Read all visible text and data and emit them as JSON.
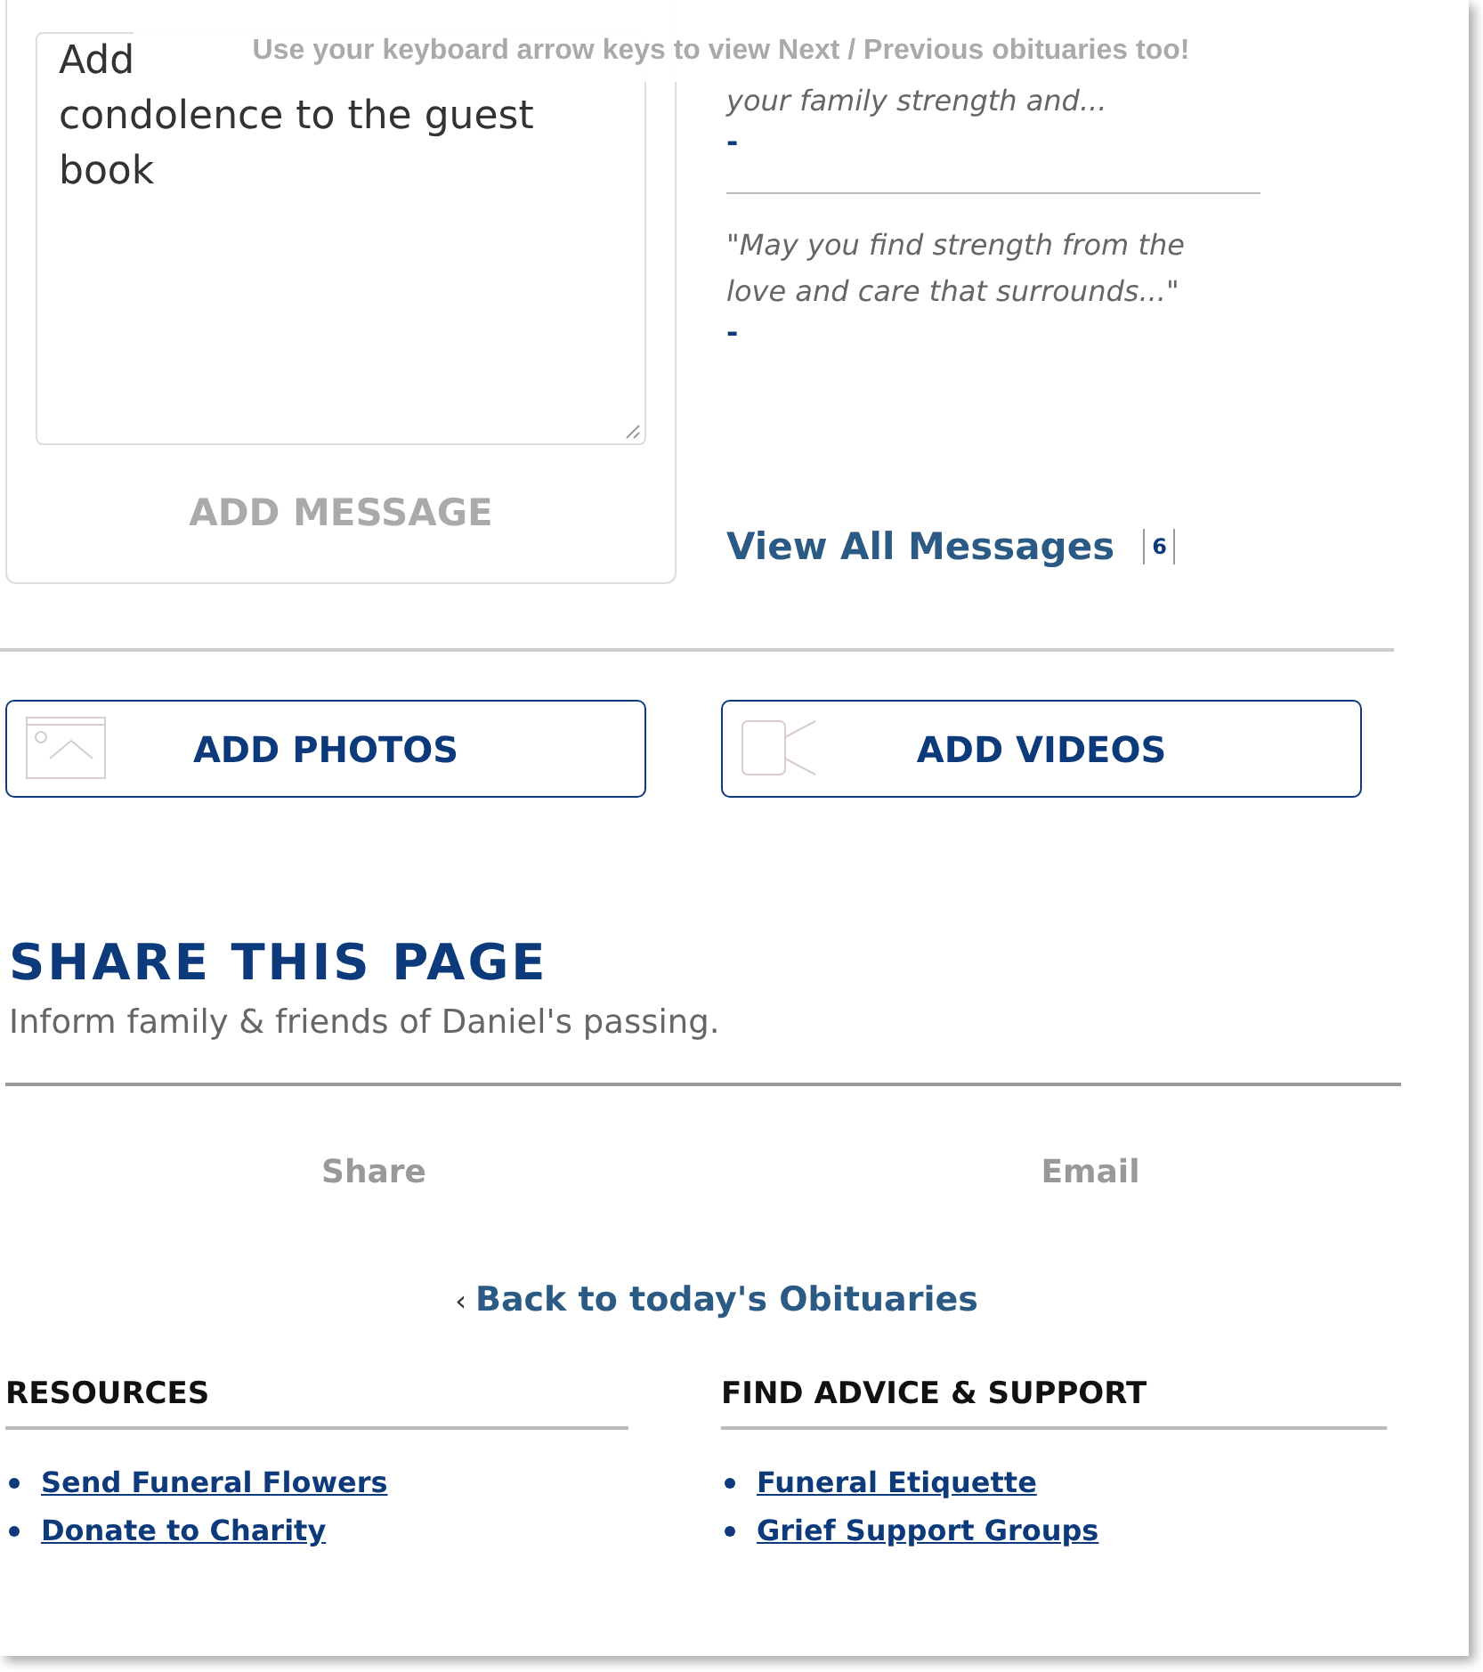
{
  "banner": "Use your keyboard arrow keys to view Next / Previous obituaries too!",
  "message_form": {
    "value_lines": [
      "Add",
      "condolence to the guest",
      "book"
    ],
    "button": "ADD MESSAGE"
  },
  "messages": [
    {
      "text": "your family strength and...",
      "author": "-"
    },
    {
      "text": "\"May you find strength from the love and care that surrounds...\"",
      "author": "-"
    }
  ],
  "view_all": {
    "label": "View All Messages",
    "count": "6"
  },
  "media_buttons": [
    {
      "kind": "photos",
      "label": "ADD PHOTOS"
    },
    {
      "kind": "videos",
      "label": "ADD VIDEOS"
    }
  ],
  "share": {
    "title": "SHARE THIS PAGE",
    "subtitle": "Inform family & friends of Daniel's passing.",
    "options": [
      "Share",
      "Email"
    ]
  },
  "back_link": {
    "arrow": "‹",
    "label": "Back to today's Obituaries"
  },
  "footer_sections": [
    {
      "title": "RESOURCES",
      "links": [
        "Send Funeral Flowers",
        "Donate to Charity"
      ]
    },
    {
      "title": "FIND ADVICE & SUPPORT",
      "links": [
        "Funeral Etiquette",
        "Grief Support Groups"
      ]
    }
  ]
}
